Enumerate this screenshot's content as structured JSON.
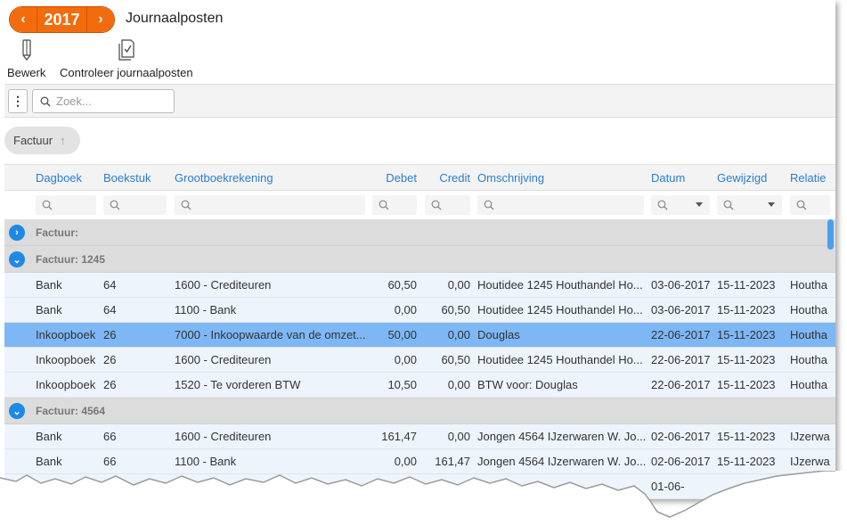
{
  "header": {
    "year": "2017",
    "title": "Journaalposten",
    "prev_label": "‹",
    "next_label": "›"
  },
  "toolbar": {
    "edit_label": "Bewerk",
    "check_label": "Controleer journaalposten"
  },
  "search": {
    "placeholder": "Zoek...",
    "menu_label": "⋮"
  },
  "grouping": {
    "chip_label": "Factuur",
    "sort_arrow": "↑"
  },
  "columns": [
    "Dagboek",
    "Boekstuk",
    "Grootboekrekening",
    "Debet",
    "Credit",
    "Omschrijving",
    "Datum",
    "Gewijzigd",
    "Relatie"
  ],
  "groups": [
    {
      "label": "Factuur:",
      "expanded": false,
      "rows": []
    },
    {
      "label": "Factuur: 1245",
      "expanded": true,
      "rows": [
        {
          "dagboek": "Bank",
          "boekstuk": "64",
          "grootboek": "1600 - Crediteuren",
          "debet": "60,50",
          "credit": "0,00",
          "omschrijving": "Houtidee 1245 Houthandel Ho...",
          "datum": "03-06-2017",
          "gewijzigd": "15-11-2023",
          "relatie": "Houtha",
          "selected": false
        },
        {
          "dagboek": "Bank",
          "boekstuk": "64",
          "grootboek": "1100 - Bank",
          "debet": "0,00",
          "credit": "60,50",
          "omschrijving": "Houtidee 1245 Houthandel Ho...",
          "datum": "03-06-2017",
          "gewijzigd": "15-11-2023",
          "relatie": "Houtha",
          "selected": false
        },
        {
          "dagboek": "Inkoopboek",
          "boekstuk": "26",
          "grootboek": "7000 - Inkoopwaarde van de omzet...",
          "debet": "50,00",
          "credit": "0,00",
          "omschrijving": "Douglas",
          "datum": "22-06-2017",
          "gewijzigd": "15-11-2023",
          "relatie": "Houtha",
          "selected": true
        },
        {
          "dagboek": "Inkoopboek",
          "boekstuk": "26",
          "grootboek": "1600 - Crediteuren",
          "debet": "0,00",
          "credit": "60,50",
          "omschrijving": "Houtidee 1245 Houthandel Ho...",
          "datum": "22-06-2017",
          "gewijzigd": "15-11-2023",
          "relatie": "Houtha",
          "selected": false
        },
        {
          "dagboek": "Inkoopboek",
          "boekstuk": "26",
          "grootboek": "1520 - Te vorderen BTW",
          "debet": "10,50",
          "credit": "0,00",
          "omschrijving": "BTW voor: Douglas",
          "datum": "22-06-2017",
          "gewijzigd": "15-11-2023",
          "relatie": "Houtha",
          "selected": false
        }
      ]
    },
    {
      "label": "Factuur: 4564",
      "expanded": true,
      "rows": [
        {
          "dagboek": "Bank",
          "boekstuk": "66",
          "grootboek": "1600 - Crediteuren",
          "debet": "161,47",
          "credit": "0,00",
          "omschrijving": "Jongen 4564 IJzerwaren W. Jo...",
          "datum": "02-06-2017",
          "gewijzigd": "15-11-2023",
          "relatie": "IJzerwa",
          "selected": false
        },
        {
          "dagboek": "Bank",
          "boekstuk": "66",
          "grootboek": "1100 - Bank",
          "debet": "0,00",
          "credit": "161,47",
          "omschrijving": "Jongen 4564 IJzerwaren W. Jo...",
          "datum": "02-06-2017",
          "gewijzigd": "15-11-2023",
          "relatie": "IJzerwa",
          "selected": false
        },
        {
          "dagboek": "",
          "boekstuk": "",
          "grootboek": "",
          "debet": "",
          "credit": "",
          "omschrijving": "",
          "datum": "01-06-",
          "gewijzigd": "",
          "relatie": "",
          "selected": false
        }
      ]
    }
  ],
  "colors": {
    "accent_orange": "#f26c0d",
    "link_blue": "#2a7ed3",
    "selected_row": "#7eb7f5",
    "row_bg": "#eef4fc",
    "group_bg": "#dcdcdc"
  }
}
